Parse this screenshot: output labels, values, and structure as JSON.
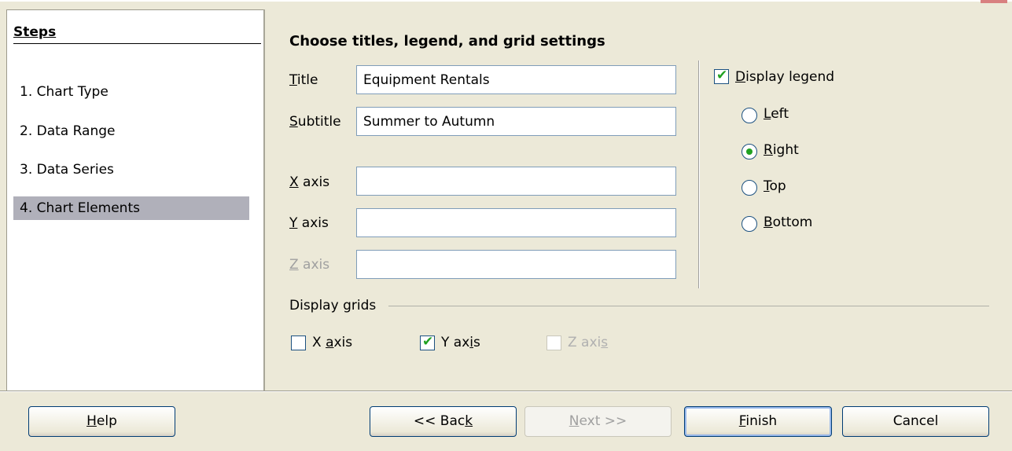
{
  "steps": {
    "title": "Steps",
    "items": [
      {
        "label": "1. Chart Type"
      },
      {
        "label": "2. Data Range"
      },
      {
        "label": "3. Data Series"
      },
      {
        "label": "4. Chart Elements",
        "active": true
      }
    ]
  },
  "main": {
    "heading": "Choose titles, legend, and grid settings",
    "title_field": {
      "label": "Title",
      "value": "Equipment Rentals"
    },
    "subtitle_field": {
      "label": "Subtitle",
      "value": "Summer to Autumn"
    },
    "x_axis_field": {
      "label": "X axis",
      "value": ""
    },
    "y_axis_field": {
      "label": "Y axis",
      "value": ""
    },
    "z_axis_field": {
      "label": "Z axis",
      "value": "",
      "disabled": true
    }
  },
  "legend": {
    "display_label": "Display legend",
    "display_checked": true,
    "options": [
      {
        "label": "Left",
        "selected": false
      },
      {
        "label": "Right",
        "selected": true
      },
      {
        "label": "Top",
        "selected": false
      },
      {
        "label": "Bottom",
        "selected": false
      }
    ]
  },
  "grids": {
    "label": "Display grids",
    "x": {
      "label": "X axis",
      "checked": false
    },
    "y": {
      "label": "Y axis",
      "checked": true
    },
    "z": {
      "label": "Z axis",
      "checked": false,
      "disabled": true
    }
  },
  "buttons": {
    "help": "Help",
    "back": "<< Back",
    "next": "Next >>",
    "finish": "Finish",
    "cancel": "Cancel"
  },
  "colors": {
    "dialog_bg": "#ECE9D8",
    "active_step": "#B0B0BA",
    "check_mark": "#21A121"
  }
}
